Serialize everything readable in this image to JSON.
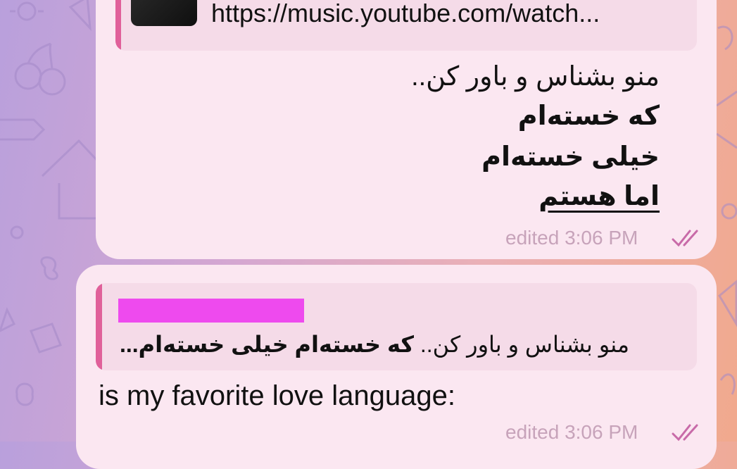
{
  "message1": {
    "link_url": "https://music.youtube.com/watch...",
    "lines": [
      "منو بشناس و باور کن..",
      "که خسته‌ام",
      "خیلی خسته‌ام",
      "اما هستم"
    ],
    "meta": "edited 3:06 PM"
  },
  "message2": {
    "reply_quote_plain": "منو بشناس و باور کن.. ",
    "reply_quote_bold": "که خسته‌ام خیلی خسته‌ام...",
    "text": "is my favorite love language:",
    "meta": "edited 3:06 PM"
  },
  "colors": {
    "accent": "#e0609a",
    "redacted_name": "#ee4aee",
    "bubble": "#fbe7f1",
    "meta_text": "#c7a3ba"
  },
  "icons": [
    "double-check-icon"
  ]
}
